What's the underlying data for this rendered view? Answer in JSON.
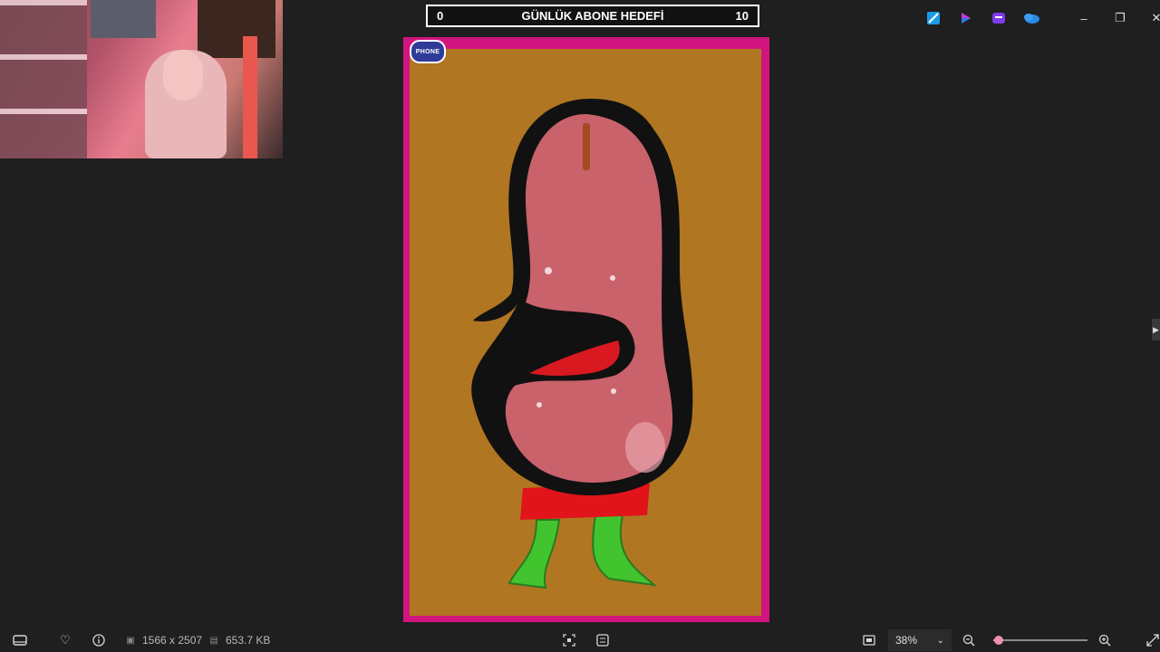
{
  "goal_widget": {
    "min": "0",
    "title": "GÜNLÜK ABONE HEDEFİ",
    "max": "10"
  },
  "image": {
    "badge_text": "PHONE"
  },
  "statusbar": {
    "dimensions": "1566 x 2507",
    "file_size": "653.7 KB",
    "zoom": "38%",
    "zoom_fraction": 0.06
  },
  "colors": {
    "frame": "#d1157f",
    "canvas": "#b07621",
    "slider": "#f08fb0"
  },
  "icons": [
    "filmstrip-icon",
    "heart-icon",
    "info-icon",
    "image-size-icon",
    "file-icon",
    "crop-icon",
    "edit-icon",
    "fit-screen-icon",
    "chevron-down-icon",
    "zoom-out-icon",
    "zoom-in-icon",
    "fullscreen-icon",
    "minimize-icon",
    "maximize-icon",
    "close-icon"
  ]
}
